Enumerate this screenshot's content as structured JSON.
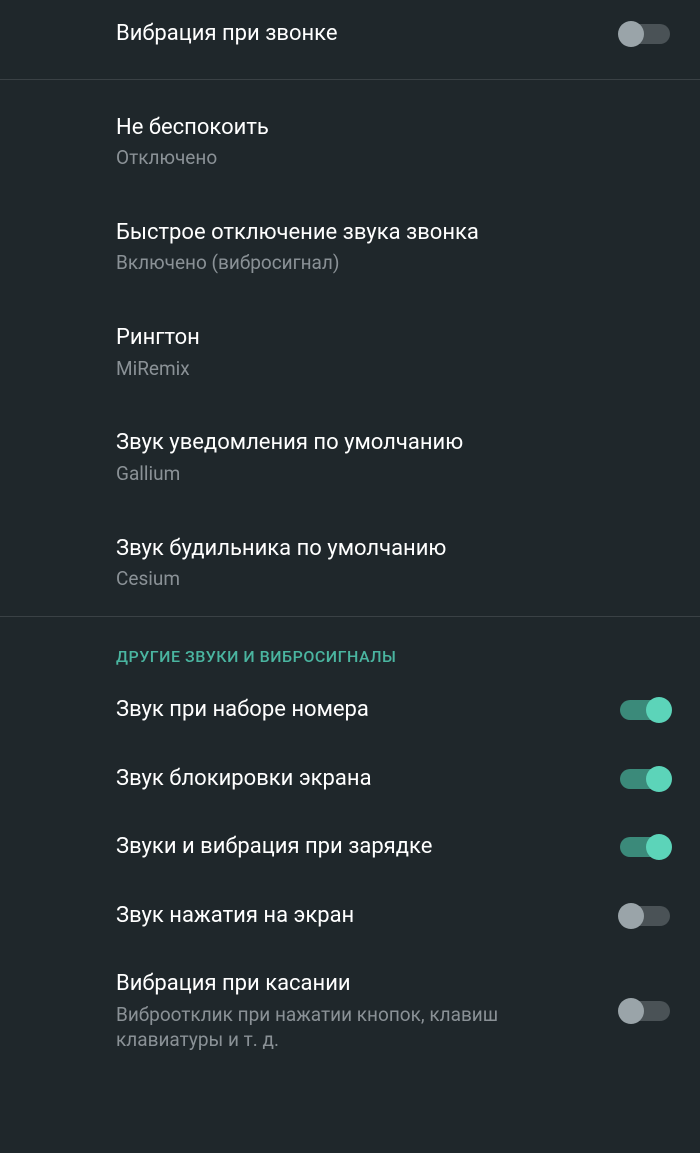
{
  "section1": {
    "vibrate_on_call": {
      "title": "Вибрация при звонке",
      "enabled": false
    }
  },
  "section2": {
    "do_not_disturb": {
      "title": "Не беспокоить",
      "subtitle": "Отключено"
    },
    "quick_mute": {
      "title": "Быстрое отключение звука звонка",
      "subtitle": "Включено (вибросигнал)"
    },
    "ringtone": {
      "title": "Рингтон",
      "subtitle": "MiRemix"
    },
    "notification_sound": {
      "title": "Звук уведомления по умолчанию",
      "subtitle": "Gallium"
    },
    "alarm_sound": {
      "title": "Звук будильника по умолчанию",
      "subtitle": "Cesium"
    }
  },
  "section3": {
    "header": "ДРУГИЕ ЗВУКИ И ВИБРОСИГНАЛЫ",
    "dial_pad_tones": {
      "title": "Звук при наборе номера",
      "enabled": true
    },
    "screen_lock_sound": {
      "title": "Звук блокировки экрана",
      "enabled": true
    },
    "charging_sounds": {
      "title": "Звуки и вибрация при зарядке",
      "enabled": true
    },
    "touch_sounds": {
      "title": "Звук нажатия на экран",
      "enabled": false
    },
    "touch_vibration": {
      "title": "Вибрация при касании",
      "subtitle": "Виброотклик при нажатии кнопок, клавиш клавиатуры и т. д.",
      "enabled": false
    }
  }
}
